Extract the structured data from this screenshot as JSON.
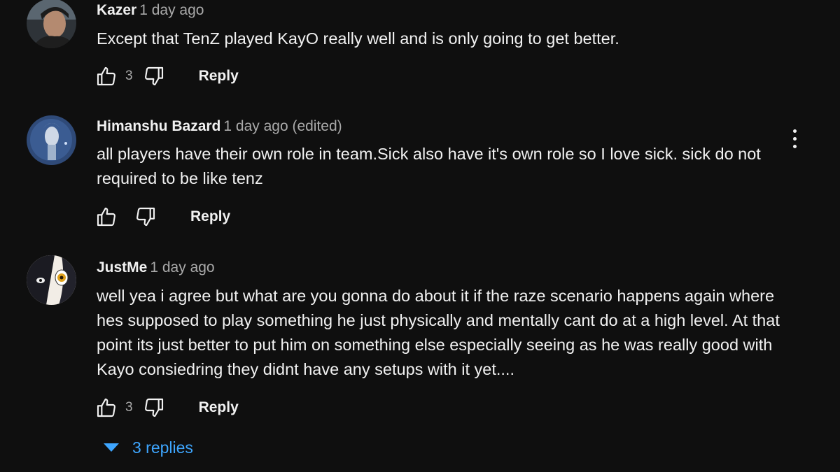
{
  "colors": {
    "background": "#0f0f0f",
    "text_primary": "#f1f1f1",
    "text_secondary": "#aaaaaa",
    "link_blue": "#3ea6ff"
  },
  "comments": [
    {
      "author": "Kazer",
      "time": "1 day ago",
      "text": "Except that TenZ played KayO really well and is only going to get better.",
      "like_count": "3",
      "reply_label": "Reply",
      "avatar_icon": "user-avatar"
    },
    {
      "author": "Himanshu Bazard",
      "time": "1 day ago (edited)",
      "text": "all players have their own role in team.Sick also have it's own role so I love sick. sick do not required to be like tenz",
      "like_count": "",
      "reply_label": "Reply",
      "avatar_icon": "user-avatar"
    },
    {
      "author": "JustMe",
      "time": "1 day ago",
      "text": "well yea i agree but what are you gonna do about it if the raze scenario happens again where hes supposed to play something he just physically and mentally cant do at a high level. At that point its just better to put him on something else especially seeing as he was really good with Kayo consiedring they didnt have any setups with it yet....",
      "like_count": "3",
      "reply_label": "Reply",
      "avatar_icon": "user-avatar"
    }
  ],
  "replies_toggle": {
    "label": "3 replies",
    "icon": "triangle-down-icon"
  },
  "menu_icon": "more-vertical-icon"
}
